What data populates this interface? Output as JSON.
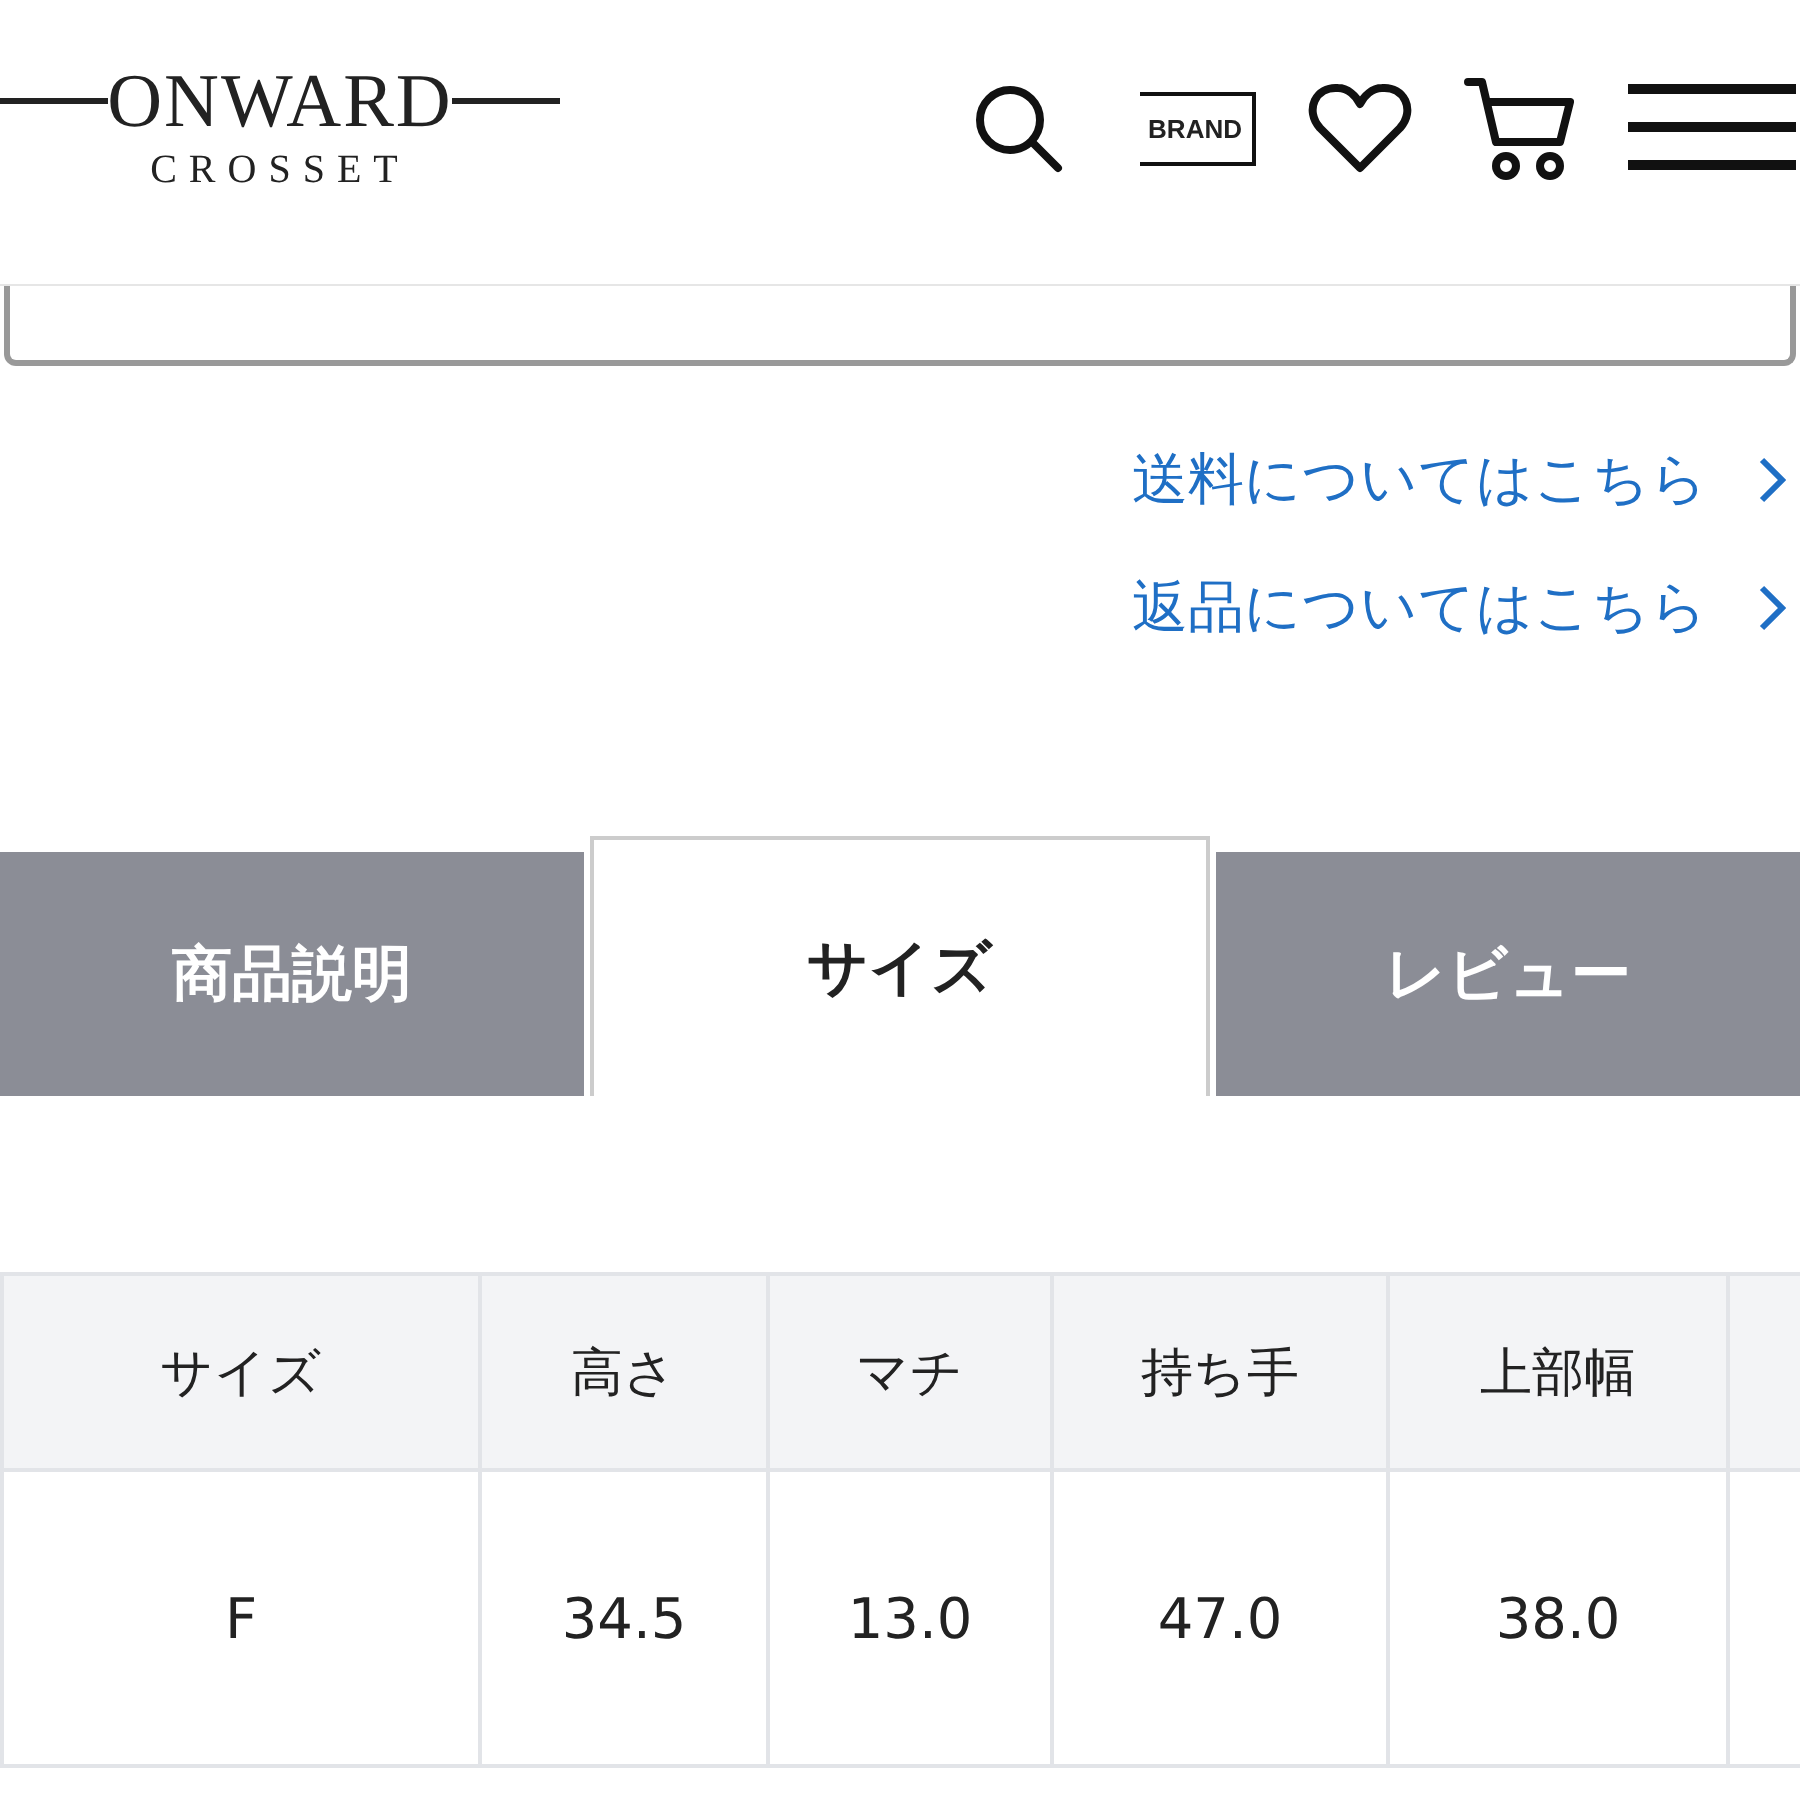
{
  "header": {
    "logo": "ONWARD",
    "logo_sub": "CROSSET",
    "brand_badge": "BRAND"
  },
  "links": [
    {
      "label": "送料についてはこちら"
    },
    {
      "label": "返品についてはこちら"
    }
  ],
  "tabs": [
    {
      "label": "商品説明",
      "selected": false
    },
    {
      "label": "サイズ",
      "selected": true
    },
    {
      "label": "レビュー",
      "selected": false
    }
  ],
  "size_table": {
    "columns": [
      "サイズ",
      "高さ",
      "マチ",
      "持ち手",
      "上部幅"
    ],
    "rows": [
      [
        "F",
        "34.5",
        "13.0",
        "47.0",
        "38.0"
      ]
    ]
  }
}
